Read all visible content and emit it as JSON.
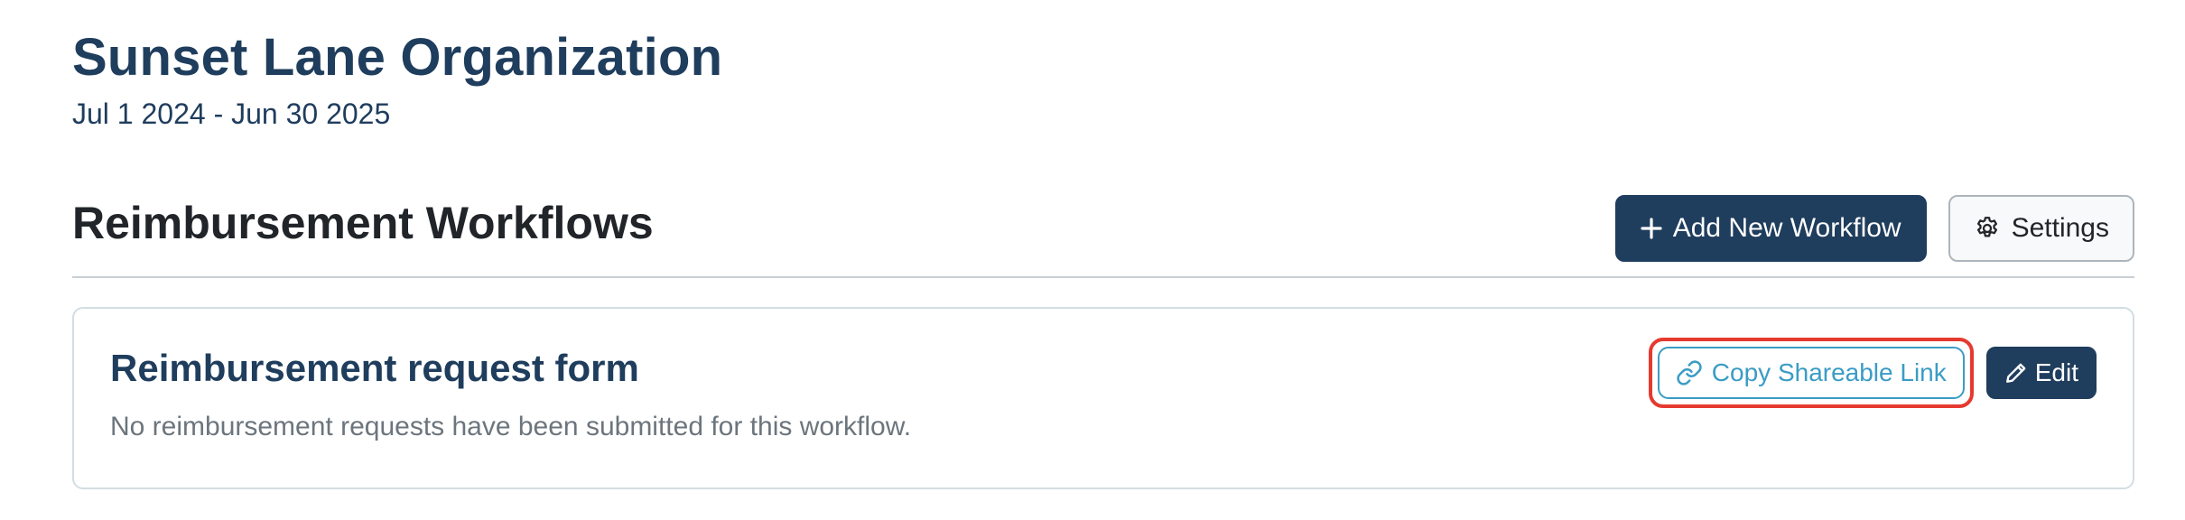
{
  "organization": {
    "name": "Sunset Lane Organization",
    "date_range": "Jul 1 2024 - Jun 30 2025"
  },
  "section": {
    "title": "Reimbursement Workflows",
    "add_button_label": "Add New Workflow",
    "add_button_icon": "plus-icon",
    "settings_button_label": "Settings",
    "settings_button_icon": "gear-icon"
  },
  "workflows": [
    {
      "title": "Reimbursement request form",
      "status_text": "No reimbursement requests have been submitted for this workflow.",
      "copy_link_label": "Copy Shareable Link",
      "copy_link_icon": "link-icon",
      "edit_label": "Edit",
      "edit_icon": "pencil-icon"
    }
  ],
  "colors": {
    "brand": "#1f3d5d",
    "link": "#3a9cc5",
    "highlight": "#e53a2f",
    "muted_text": "#6c757d"
  }
}
